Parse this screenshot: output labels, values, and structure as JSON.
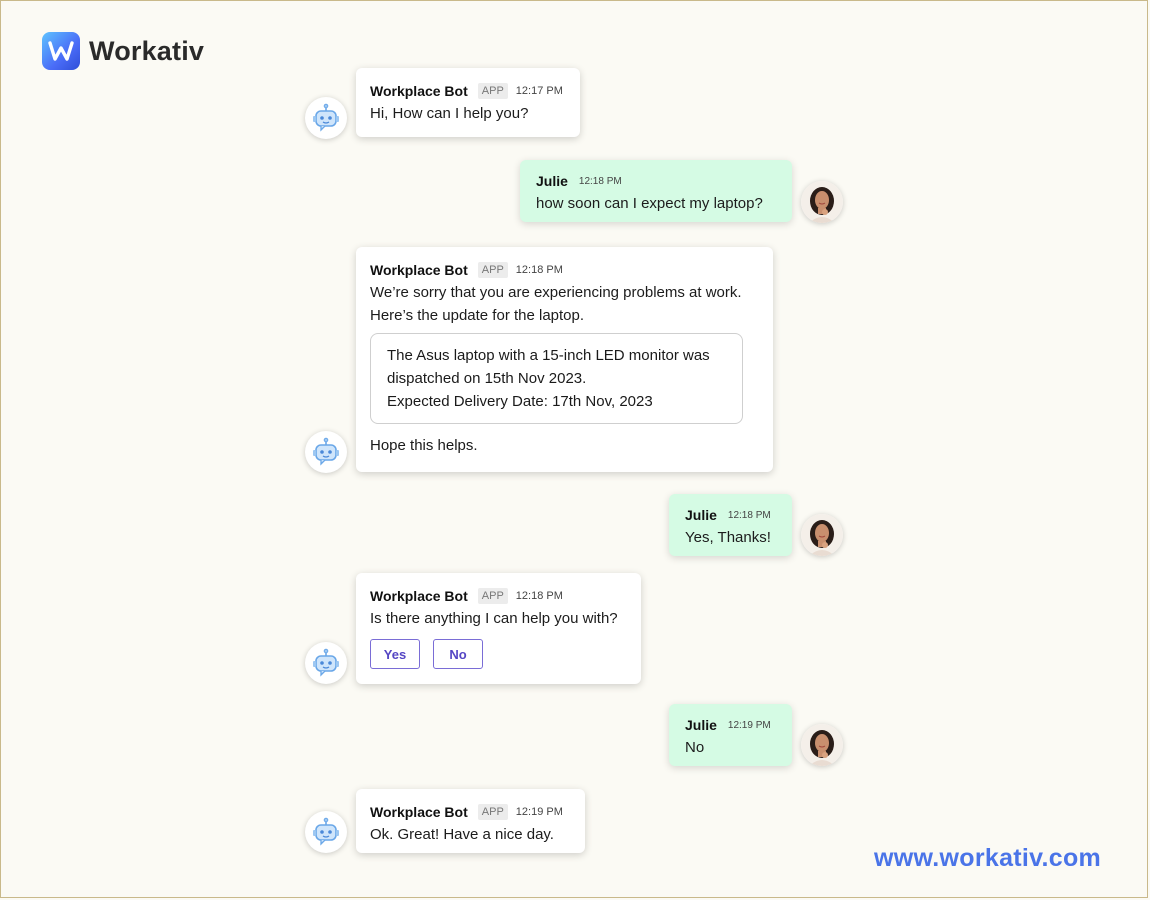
{
  "brand": {
    "name": "Workativ",
    "url": "www.workativ.com"
  },
  "messages": [
    {
      "name": "Workplace Bot",
      "badge": "APP",
      "time": "12:17 PM",
      "text": "Hi, How can I help you?"
    },
    {
      "name": "Julie",
      "time": "12:18 PM",
      "text": "how soon can I expect my laptop?"
    },
    {
      "name": "Workplace Bot",
      "badge": "APP",
      "time": "12:18 PM",
      "text": "We’re sorry that you are experiencing problems at work. Here’s the update for the laptop.",
      "card": {
        "line1": "The Asus laptop with a 15-inch LED monitor was dispatched on 15th Nov 2023.",
        "line2": "Expected Delivery Date: 17th Nov, 2023"
      },
      "after": "Hope this helps."
    },
    {
      "name": "Julie",
      "time": "12:18 PM",
      "text": "Yes, Thanks!"
    },
    {
      "name": "Workplace Bot",
      "badge": "APP",
      "time": "12:18 PM",
      "text": "Is there anything I can help you with?",
      "buttons": [
        "Yes",
        "No"
      ]
    },
    {
      "name": "Julie",
      "time": "12:19 PM",
      "text": "No"
    },
    {
      "name": "Workplace Bot",
      "badge": "APP",
      "time": "12:19 PM",
      "text": "Ok. Great! Have a nice day."
    }
  ],
  "icons": {
    "bot": "robot-icon",
    "user": "user-avatar"
  },
  "colors": {
    "user_bubble": "#d5fbe4",
    "bot_bubble": "#ffffff",
    "accent": "#4a74e8",
    "button_border": "#7a6dd6"
  }
}
